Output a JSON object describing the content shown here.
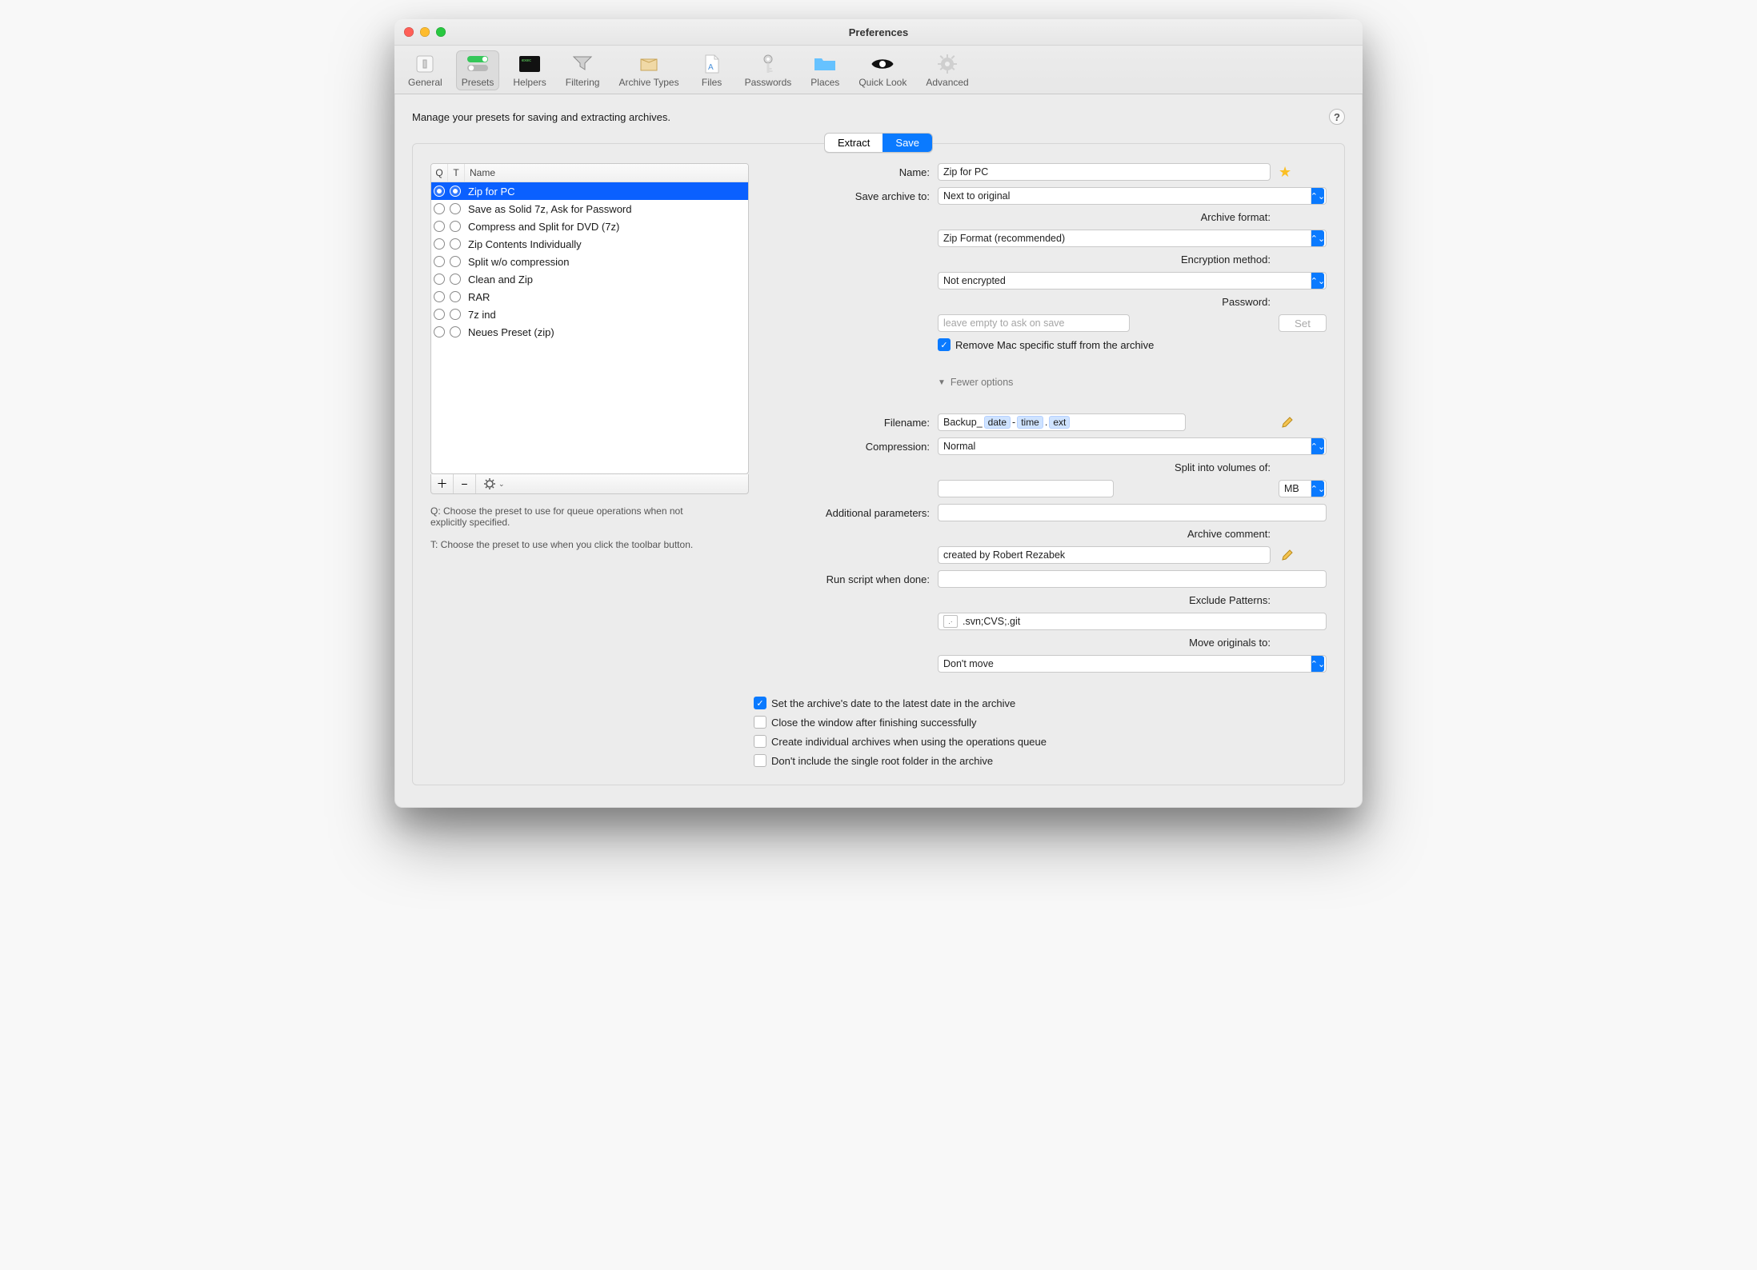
{
  "window": {
    "title": "Preferences"
  },
  "toolbar": {
    "items": [
      {
        "id": "general",
        "label": "General"
      },
      {
        "id": "presets",
        "label": "Presets"
      },
      {
        "id": "helpers",
        "label": "Helpers"
      },
      {
        "id": "filtering",
        "label": "Filtering"
      },
      {
        "id": "archiveTypes",
        "label": "Archive Types"
      },
      {
        "id": "files",
        "label": "Files"
      },
      {
        "id": "passwords",
        "label": "Passwords"
      },
      {
        "id": "places",
        "label": "Places"
      },
      {
        "id": "quickLook",
        "label": "Quick Look"
      },
      {
        "id": "advanced",
        "label": "Advanced"
      }
    ],
    "active": "presets"
  },
  "page": {
    "instruction": "Manage your presets for saving and extracting archives.",
    "help": "?",
    "segmented": {
      "extract": "Extract",
      "save": "Save",
      "selected": "save"
    }
  },
  "presets": {
    "headers": {
      "q": "Q",
      "t": "T",
      "name": "Name"
    },
    "items": [
      {
        "name": "Zip for PC",
        "q": true,
        "t": true,
        "selected": true
      },
      {
        "name": "Save as Solid 7z, Ask for Password",
        "q": false,
        "t": false
      },
      {
        "name": "Compress and Split for DVD (7z)",
        "q": false,
        "t": false
      },
      {
        "name": "Zip Contents Individually",
        "q": false,
        "t": false
      },
      {
        "name": "Split w/o compression",
        "q": false,
        "t": false
      },
      {
        "name": "Clean and Zip",
        "q": false,
        "t": false
      },
      {
        "name": "RAR",
        "q": false,
        "t": false
      },
      {
        "name": "7z ind",
        "q": false,
        "t": false
      },
      {
        "name": "Neues Preset (zip)",
        "q": false,
        "t": false
      }
    ],
    "hints": {
      "q": "Q: Choose the preset to use for queue operations when not explicitly specified.",
      "t": "T: Choose the preset to use when you click the toolbar button."
    }
  },
  "form": {
    "name": {
      "label": "Name:",
      "value": "Zip for PC"
    },
    "saveTo": {
      "label": "Save archive to:",
      "value": "Next to original"
    },
    "format": {
      "label": "Archive format:",
      "value": "Zip Format (recommended)"
    },
    "encryption": {
      "label": "Encryption method:",
      "value": "Not encrypted"
    },
    "password": {
      "label": "Password:",
      "placeholder": "leave empty to ask on save",
      "button": "Set"
    },
    "removeMac": {
      "label": "Remove Mac specific stuff from the archive",
      "checked": true
    },
    "disclosure": "Fewer options",
    "filename": {
      "label": "Filename:",
      "base": "Backup_",
      "tokens": [
        "date",
        "time",
        "ext"
      ],
      "sep": " - ",
      "editTitle": "Edit"
    },
    "compression": {
      "label": "Compression:",
      "value": "Normal"
    },
    "split": {
      "label": "Split into volumes of:",
      "value": "",
      "unit": "MB"
    },
    "additional": {
      "label": "Additional parameters:",
      "value": ""
    },
    "comment": {
      "label": "Archive comment:",
      "value": "created by Robert Rezabek"
    },
    "runScript": {
      "label": "Run script when done:",
      "value": ""
    },
    "excludePatterns": {
      "label": "Exclude Patterns:",
      "value": ".svn;CVS;.git"
    },
    "moveOriginals": {
      "label": "Move originals to:",
      "value": "Don't move"
    },
    "options": [
      {
        "label": "Set the archive's date to the latest date in the archive",
        "checked": true
      },
      {
        "label": "Close the window after finishing successfully",
        "checked": false
      },
      {
        "label": "Create individual archives when using the operations queue",
        "checked": false
      },
      {
        "label": "Don't include the single root folder in the archive",
        "checked": false
      }
    ]
  }
}
